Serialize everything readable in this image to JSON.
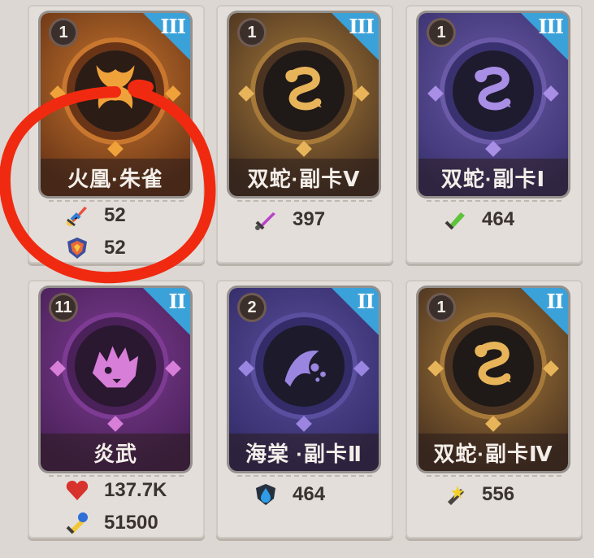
{
  "cards": [
    {
      "level": "1",
      "rank": "III",
      "name": "火凰·朱雀",
      "theme": "orange",
      "frame_color": "#c9772f",
      "ring_color": "#6a3516",
      "inner_color": "#2b1c16",
      "glyph_color": "#f0a23a",
      "emblem": "phoenix-emblem",
      "stats": [
        {
          "icon": "rainbow-sword-icon",
          "value": "52"
        },
        {
          "icon": "rainbow-shield-icon",
          "value": "52"
        }
      ]
    },
    {
      "level": "1",
      "rank": "III",
      "name": "双蛇·副卡Ⅴ",
      "theme": "gold",
      "frame_color": "#a77a3a",
      "ring_color": "#4a3320",
      "inner_color": "#1f1a17",
      "glyph_color": "#e8b45a",
      "emblem": "serpent-emblem",
      "stats": [
        {
          "icon": "purple-sword-icon",
          "value": "397"
        }
      ]
    },
    {
      "level": "1",
      "rank": "III",
      "name": "双蛇·副卡Ⅰ",
      "theme": "violet",
      "frame_color": "#6b5aa8",
      "ring_color": "#3a3270",
      "inner_color": "#1f1b2f",
      "glyph_color": "#a98ee6",
      "emblem": "serpent-emblem",
      "stats": [
        {
          "icon": "green-sword-icon",
          "value": "464"
        }
      ]
    },
    {
      "level": "11",
      "rank": "II",
      "name": "炎武",
      "theme": "purple",
      "frame_color": "#7d3b93",
      "ring_color": "#4a2158",
      "inner_color": "#2a1730",
      "glyph_color": "#d77ed9",
      "emblem": "beast-emblem",
      "stats": [
        {
          "icon": "red-heart-icon",
          "value": "137.7K"
        },
        {
          "icon": "blue-sword-icon",
          "value": "51500"
        }
      ]
    },
    {
      "level": "2",
      "rank": "II",
      "name": "海棠 ·副卡Ⅱ",
      "theme": "violet",
      "frame_color": "#5a4f9e",
      "ring_color": "#332c68",
      "inner_color": "#1d1a2c",
      "glyph_color": "#9a86e0",
      "emblem": "fish-emblem",
      "stats": [
        {
          "icon": "blue-drop-shield-icon",
          "value": "464"
        }
      ]
    },
    {
      "level": "1",
      "rank": "II",
      "name": "双蛇·副卡Ⅳ",
      "theme": "gold",
      "frame_color": "#a77a3a",
      "ring_color": "#4a3320",
      "inner_color": "#1f1a17",
      "glyph_color": "#e8b45a",
      "emblem": "serpent-emblem",
      "stats": [
        {
          "icon": "spark-sword-icon",
          "value": "556"
        }
      ]
    }
  ],
  "annotation": {
    "color": "#f02a10"
  }
}
